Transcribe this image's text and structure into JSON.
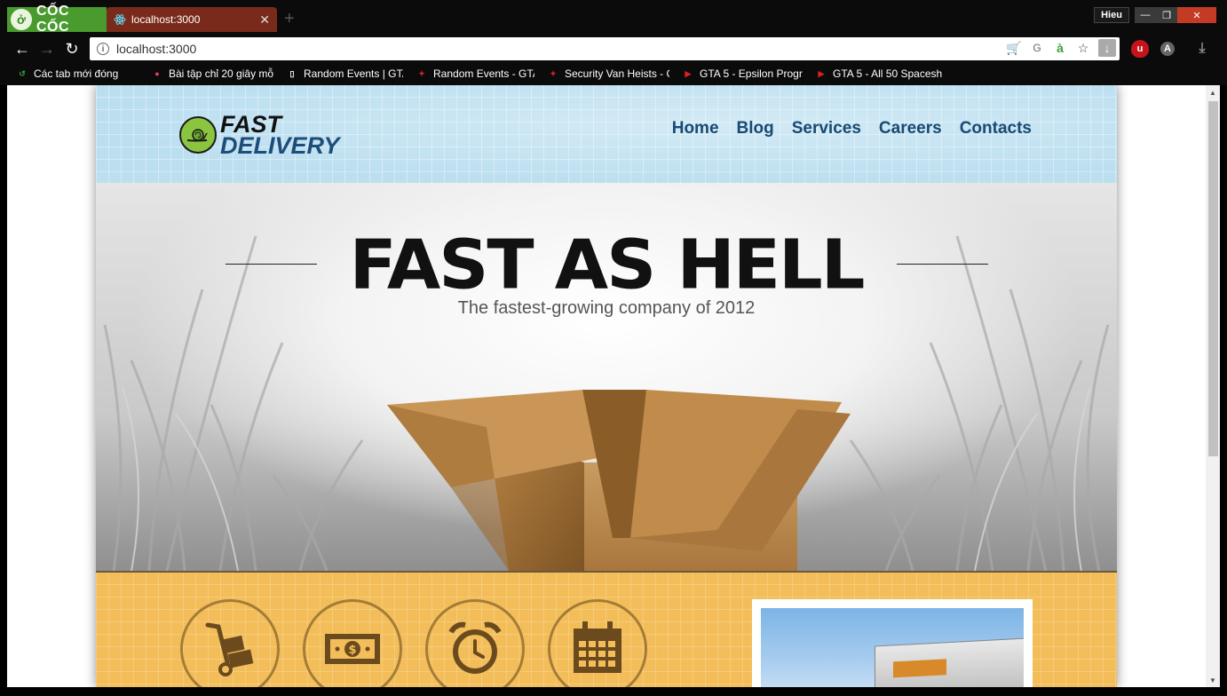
{
  "browser": {
    "brand": "CỐC CỐC",
    "tab": {
      "title": "localhost:3000",
      "close": "✕"
    },
    "new_tab": "+",
    "user": "Hieu",
    "window": {
      "minimize": "—",
      "maximize": "❐",
      "close": "✕"
    },
    "address": "localhost:3000",
    "bookmarks": [
      {
        "label": "Các tab mới đóng",
        "icon": "recent-tabs-icon",
        "color": "#3aa03a"
      },
      {
        "label": "Bài tập chỉ 20 giây mỗ",
        "icon": "pokeball-icon",
        "color": "#e0405a"
      },
      {
        "label": "Random Events | GTA",
        "icon": "page-icon",
        "color": "#ffffff"
      },
      {
        "label": "Random Events - GTA",
        "icon": "rockstar-icon",
        "color": "#d0202a"
      },
      {
        "label": "Security Van Heists - G",
        "icon": "rockstar-icon",
        "color": "#d0202a"
      },
      {
        "label": "GTA 5 - Epsilon Progr",
        "icon": "youtube-icon",
        "color": "#e02020"
      },
      {
        "label": "GTA 5 - All 50 Spacesh",
        "icon": "youtube-icon",
        "color": "#e02020"
      }
    ]
  },
  "site": {
    "logo": {
      "line1": "FAST",
      "line2": "DELIVERY"
    },
    "nav": [
      "Home",
      "Blog",
      "Services",
      "Careers",
      "Contacts"
    ],
    "hero": {
      "title": "FAST AS HELL",
      "subtitle": "The fastest-growing company of 2012"
    },
    "features": [
      {
        "icon": "hand-truck-icon"
      },
      {
        "icon": "money-icon"
      },
      {
        "icon": "alarm-clock-icon"
      },
      {
        "icon": "calendar-icon"
      }
    ],
    "colors": {
      "header_bg": "#bcdff0",
      "nav_text": "#174a74",
      "features_bg": "#f3be5a",
      "feature_icon": "#6b4a1e"
    }
  }
}
